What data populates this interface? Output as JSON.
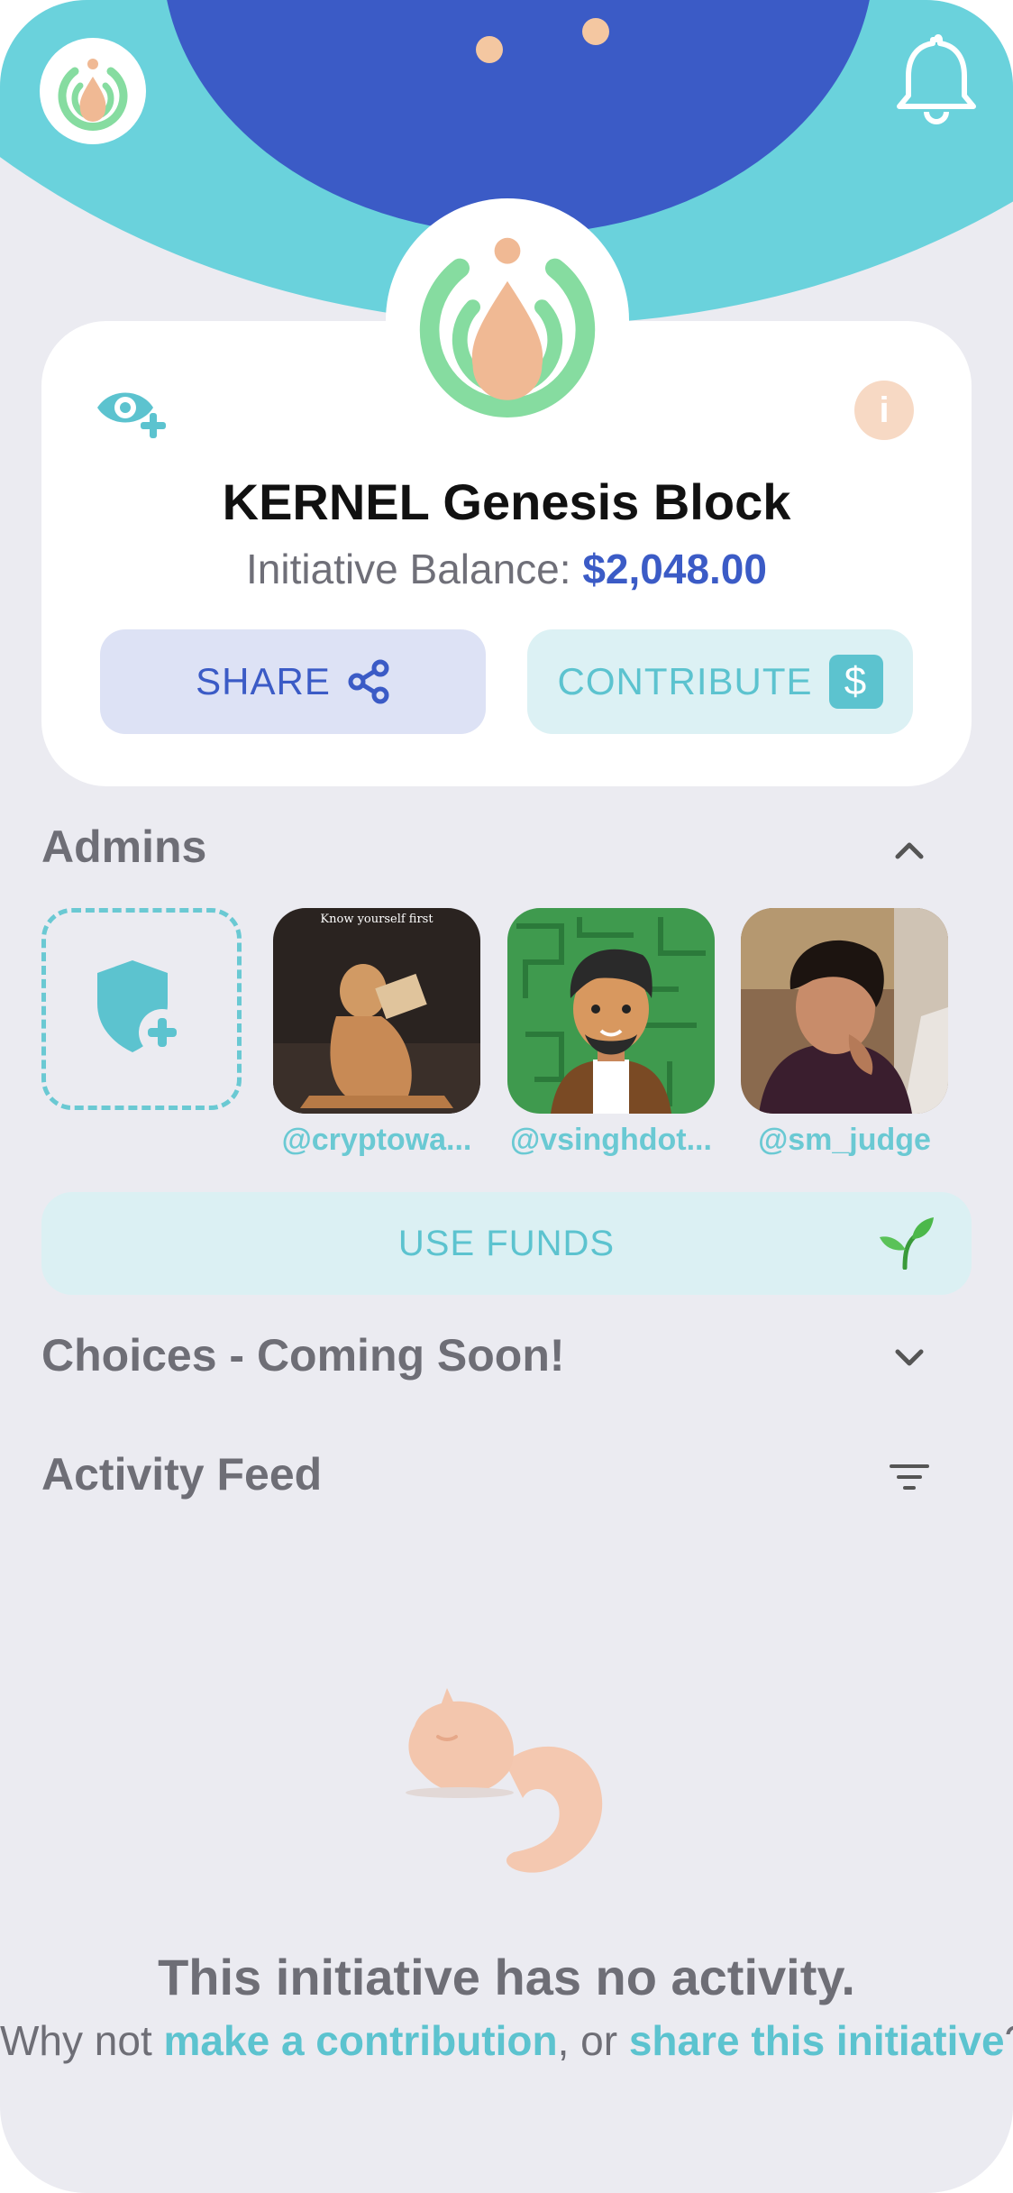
{
  "header": {
    "logo_icon": "seed-logo-icon",
    "notifications_icon": "bell-icon"
  },
  "initiative": {
    "title": "KERNEL Genesis Block",
    "balance_label": "Initiative Balance:",
    "balance_value": "$2,048.00",
    "share_label": "SHARE",
    "contribute_label": "CONTRIBUTE",
    "contribute_badge": "$",
    "info_glyph": "i"
  },
  "admins": {
    "title": "Admins",
    "items": [
      {
        "handle": "@cryptowa...",
        "image_caption": "Know yourself first"
      },
      {
        "handle": "@vsinghdot..."
      },
      {
        "handle": "@sm_judge"
      }
    ]
  },
  "use_funds": {
    "label": "USE FUNDS"
  },
  "choices": {
    "title": "Choices - Coming Soon!"
  },
  "activity": {
    "title": "Activity Feed",
    "empty_title": "This initiative has no activity.",
    "empty_prefix": "Why not ",
    "empty_link1": "make a contribution",
    "empty_mid": ", or ",
    "empty_link2": "share this initiative",
    "empty_suffix": "?"
  },
  "colors": {
    "teal": "#6ad2dc",
    "blue": "#3b5bc6",
    "peach": "#f4c7a1",
    "green": "#86dca0",
    "background": "#ebebf1"
  }
}
